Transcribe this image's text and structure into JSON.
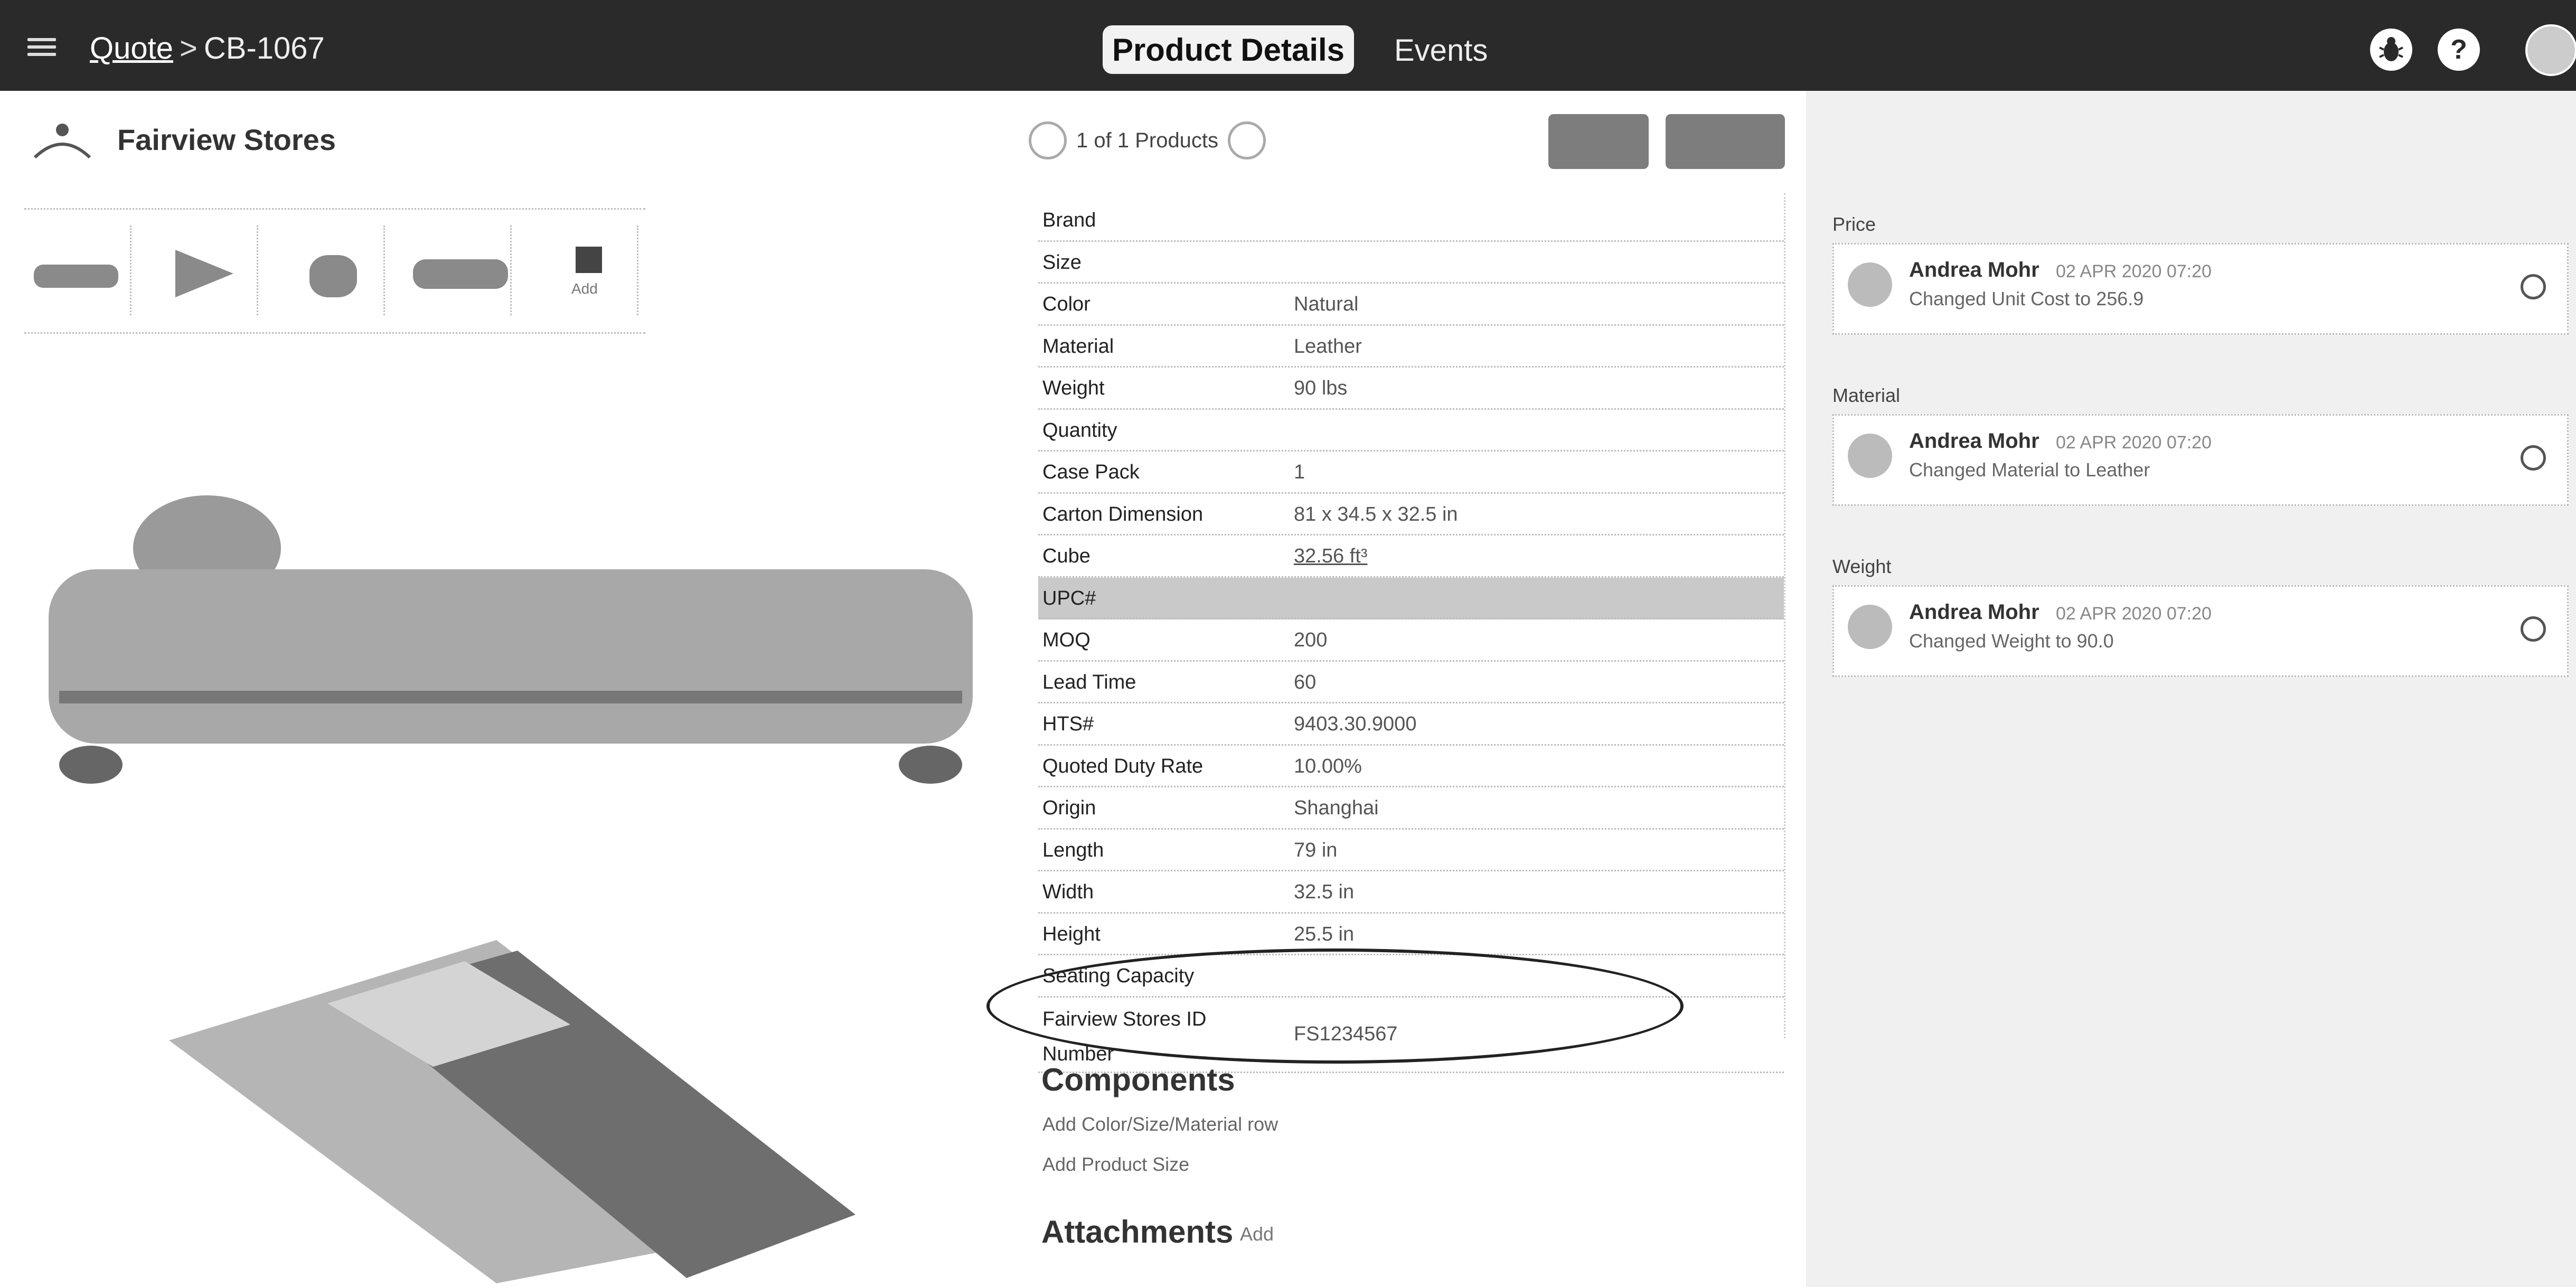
{
  "header": {
    "breadcrumb_link": "Quote",
    "breadcrumb_separator": ">",
    "breadcrumb_current": "CB-1067",
    "tabs": [
      {
        "label": "Product Details"
      },
      {
        "label": "Events"
      }
    ],
    "help_label": "?"
  },
  "product": {
    "store_name": "Fairview Stores",
    "pager_label": "1 of 1 Products",
    "thumbnail_caption": "Add",
    "button_a": "",
    "button_b": ""
  },
  "attributes": [
    {
      "key": "Brand",
      "value": ""
    },
    {
      "key": "Size",
      "value": ""
    },
    {
      "key": "Color",
      "value": "Natural"
    },
    {
      "key": "Material",
      "value": "Leather"
    },
    {
      "key": "Weight",
      "value": "90 lbs"
    },
    {
      "key": "Quantity",
      "value": ""
    },
    {
      "key": "Case Pack",
      "value": "1"
    },
    {
      "key": "Carton Dimension",
      "value": "81 x 34.5 x 32.5 in"
    },
    {
      "key": "Cube",
      "value": "32.56 ft³"
    },
    {
      "key": "UPC#",
      "value": ""
    },
    {
      "key": "MOQ",
      "value": "200"
    },
    {
      "key": "Lead Time",
      "value": "60"
    },
    {
      "key": "HTS#",
      "value": "9403.30.9000"
    },
    {
      "key": "Quoted Duty Rate",
      "value": "10.00%"
    },
    {
      "key": "Origin",
      "value": "Shanghai"
    },
    {
      "key": "Length",
      "value": "79 in"
    },
    {
      "key": "Width",
      "value": "32.5 in"
    },
    {
      "key": "Height",
      "value": "25.5 in"
    },
    {
      "key": "Seating Capacity",
      "value": ""
    },
    {
      "key": "Fairview Stores ID Number",
      "value": "FS1234567"
    }
  ],
  "components": {
    "title": "Components",
    "link1": "Add Color/Size/Material row",
    "link2": "Add Product Size"
  },
  "attachments": {
    "title": "Attachments",
    "add_label": "Add"
  },
  "events": [
    {
      "group": "Price",
      "user": "Andrea Mohr",
      "date": "02 APR 2020 07:20",
      "description": "Changed Unit Cost to 256.9"
    },
    {
      "group": "Material",
      "user": "Andrea Mohr",
      "date": "02 APR 2020 07:20",
      "description": "Changed Material to Leather"
    },
    {
      "group": "Weight",
      "user": "Andrea Mohr",
      "date": "02 APR 2020 07:20",
      "description": "Changed Weight to 90.0"
    }
  ],
  "colors": {
    "topbar": "#2a2a2a",
    "highlight_row": "#c9c9c9",
    "right_panel": "#f0f0f0"
  }
}
